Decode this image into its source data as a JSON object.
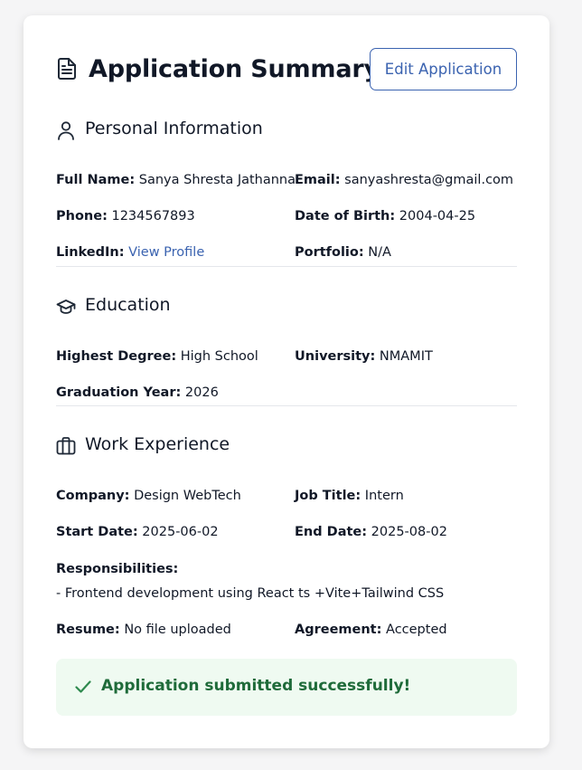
{
  "header": {
    "title": "Application Summary",
    "edit_label": "Edit Application"
  },
  "personal": {
    "title": "Personal Information",
    "full_name_label": "Full Name:",
    "full_name": "Sanya Shresta Jathanna",
    "email_label": "Email:",
    "email": "sanyashresta@gmail.com",
    "phone_label": "Phone:",
    "phone": "1234567893",
    "dob_label": "Date of Birth:",
    "dob": "2004-04-25",
    "linkedin_label": "LinkedIn:",
    "linkedin_link": "View Profile",
    "portfolio_label": "Portfolio:",
    "portfolio": "N/A"
  },
  "education": {
    "title": "Education",
    "degree_label": "Highest Degree:",
    "degree": "High School",
    "university_label": "University:",
    "university": "NMAMIT",
    "grad_year_label": "Graduation Year:",
    "grad_year": "2026"
  },
  "work": {
    "title": "Work Experience",
    "company_label": "Company:",
    "company": "Design WebTech",
    "job_title_label": "Job Title:",
    "job_title": "Intern",
    "start_label": "Start Date:",
    "start": "2025-06-02",
    "end_label": "End Date:",
    "end": "2025-08-02",
    "responsibilities_label": "Responsibilities:",
    "responsibilities": "- Frontend development using React ts +Vite+Tailwind CSS",
    "resume_label": "Resume:",
    "resume": "No file uploaded",
    "agreement_label": "Agreement:",
    "agreement": "Accepted"
  },
  "status": {
    "message": "Application submitted successfully!"
  },
  "colors": {
    "accent": "#3b63b0",
    "success_bg": "#effaf1",
    "success_text": "#1f6b3a",
    "text": "#111827"
  },
  "icons": {
    "header": "document-icon",
    "personal": "user-icon",
    "education": "graduation-cap-icon",
    "work": "briefcase-icon",
    "success": "check-icon"
  }
}
